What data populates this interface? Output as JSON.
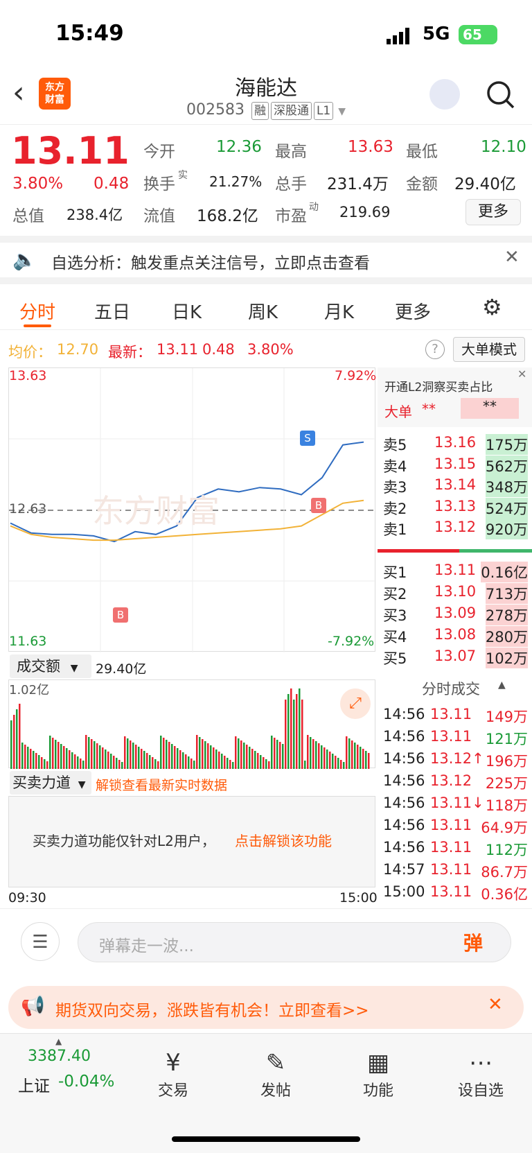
{
  "status": {
    "time": "15:49",
    "network": "5G",
    "battery": "65"
  },
  "header": {
    "logo_line1": "东方",
    "logo_line2": "财富",
    "title": "海能达",
    "code": "002583",
    "tags": [
      "融",
      "深股通",
      "L1"
    ]
  },
  "quote": {
    "price": "13.11",
    "change_pct": "3.80%",
    "change": "0.48",
    "open_label": "今开",
    "open": "12.36",
    "high_label": "最高",
    "high": "13.63",
    "low_label": "最低",
    "low": "12.10",
    "turnover_label": "换手",
    "turnover_sup": "实",
    "turnover": "21.27%",
    "volume_label": "总手",
    "volume": "231.4万",
    "amount_label": "金额",
    "amount": "29.40亿",
    "mktcap_label": "总值",
    "mktcap": "238.4亿",
    "float_label": "流值",
    "float": "168.2亿",
    "pe_label": "市盈",
    "pe_sup": "动",
    "pe": "219.69",
    "more": "更多"
  },
  "notice": {
    "text": "自选分析：触发重点关注信号，立即点击查看"
  },
  "tabs": [
    "分时",
    "五日",
    "日K",
    "周K",
    "月K",
    "更多"
  ],
  "info_line": {
    "avg_label": "均价：",
    "avg": "12.70",
    "latest_label": "最新：",
    "latest": "13.11",
    "chg": "0.48",
    "pct": "3.80%",
    "mode": "大单模式"
  },
  "chart": {
    "top_price": "13.63",
    "mid_price": "12.63",
    "bottom_price": "11.63",
    "top_pct": "7.92%",
    "bottom_pct": "-7.92%",
    "watermark": "东方财富",
    "start_time": "09:30",
    "end_time": "15:00"
  },
  "chart_data": {
    "type": "line",
    "title": "",
    "x": [
      "09:30",
      "09:45",
      "10:00",
      "10:15",
      "10:30",
      "10:45",
      "11:00",
      "11:15",
      "11:30",
      "13:00",
      "13:15",
      "13:30",
      "13:45",
      "14:00",
      "14:15",
      "14:30",
      "14:45",
      "15:00"
    ],
    "series": [
      {
        "values": [
          12.54,
          12.47,
          12.46,
          12.46,
          12.45,
          12.41,
          12.48,
          12.46,
          12.52,
          12.72,
          12.78,
          12.76,
          12.79,
          12.78,
          12.74,
          12.86,
          13.09,
          13.11
        ]
      },
      {
        "values": [
          12.52,
          12.46,
          12.44,
          12.43,
          12.42,
          12.42,
          12.43,
          12.44,
          12.45,
          12.46,
          12.47,
          12.48,
          12.49,
          12.5,
          12.52,
          12.6,
          12.68,
          12.7
        ]
      }
    ],
    "ylim": [
      11.63,
      13.63
    ]
  },
  "volume": {
    "label": "成交额",
    "value": "29.40亿",
    "max": "1.02亿"
  },
  "force": {
    "label": "买卖力道",
    "unlock": "解锁查看最新实时数据",
    "message": "买卖力道功能仅针对L2用户，",
    "link": "点击解锁该功能"
  },
  "orderbook": {
    "header": "开通L2洞察买卖占比",
    "big_label": "大单",
    "big_value": "**",
    "big_value2": "**",
    "sells": [
      {
        "label": "卖5",
        "price": "13.16",
        "vol": "175万"
      },
      {
        "label": "卖4",
        "price": "13.15",
        "vol": "562万"
      },
      {
        "label": "卖3",
        "price": "13.14",
        "vol": "348万"
      },
      {
        "label": "卖2",
        "price": "13.13",
        "vol": "524万"
      },
      {
        "label": "卖1",
        "price": "13.12",
        "vol": "920万"
      }
    ],
    "buys": [
      {
        "label": "买1",
        "price": "13.11",
        "vol": "0.16亿"
      },
      {
        "label": "买2",
        "price": "13.10",
        "vol": "713万"
      },
      {
        "label": "买3",
        "price": "13.09",
        "vol": "278万"
      },
      {
        "label": "买4",
        "price": "13.08",
        "vol": "280万"
      },
      {
        "label": "买5",
        "price": "13.07",
        "vol": "102万"
      }
    ],
    "ticks_title": "分时成交",
    "ticks": [
      {
        "t": "14:56",
        "p": "13.11",
        "v": "149万"
      },
      {
        "t": "14:56",
        "p": "13.11",
        "v": "121万"
      },
      {
        "t": "14:56",
        "p": "13.12↑",
        "v": "196万"
      },
      {
        "t": "14:56",
        "p": "13.12",
        "v": "225万"
      },
      {
        "t": "14:56",
        "p": "13.11↓",
        "v": "118万"
      },
      {
        "t": "14:56",
        "p": "13.11",
        "v": "64.9万"
      },
      {
        "t": "14:56",
        "p": "13.11",
        "v": "112万"
      },
      {
        "t": "14:57",
        "p": "13.11",
        "v": "86.7万"
      },
      {
        "t": "15:00",
        "p": "13.11",
        "v": "0.36亿"
      }
    ]
  },
  "comment": {
    "placeholder": "弹幕走一波...",
    "danmu": "弹"
  },
  "ad": {
    "text": "期货双向交易，涨跌皆有机会！立即查看>>"
  },
  "bottom": {
    "index_value": "3387.40",
    "index_name": "上证",
    "index_pct": "-0.04%",
    "items": [
      "交易",
      "发帖",
      "功能",
      "设自选"
    ]
  },
  "colors": {
    "red": "#e8222d",
    "green": "#1a9a36",
    "orange": "#ff5b0a",
    "avg_line": "#f2b237",
    "price_line": "#2f6cc0"
  }
}
